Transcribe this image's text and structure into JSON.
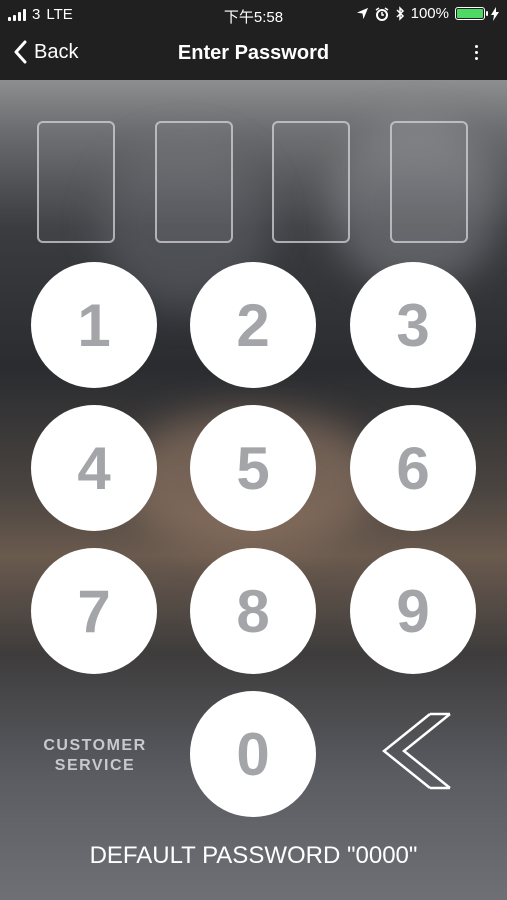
{
  "status_bar": {
    "carrier": "3",
    "network": "LTE",
    "time": "下午5:58",
    "battery": "100%"
  },
  "nav": {
    "back_label": "Back",
    "title": "Enter Password"
  },
  "keypad": {
    "keys": [
      "1",
      "2",
      "3",
      "4",
      "5",
      "6",
      "7",
      "8",
      "9",
      "0"
    ],
    "customer_service_line1": "CUSTOMER",
    "customer_service_line2": "SERVICE"
  },
  "footer": {
    "note": "DEFAULT PASSWORD \"0000\""
  },
  "colors": {
    "key_bg": "#ffffff",
    "key_digit": "#a4a5a9",
    "battery_green": "#4cd964",
    "bar_bg": "#202020"
  },
  "icons": {
    "back": "chevron-left-icon",
    "more": "more-vertical-icon",
    "delete": "double-chevron-left-icon",
    "signal": "signal-icon",
    "location": "location-arrow-icon",
    "alarm": "alarm-icon",
    "bluetooth": "bluetooth-icon",
    "battery": "battery-icon",
    "charging": "charging-icon"
  }
}
